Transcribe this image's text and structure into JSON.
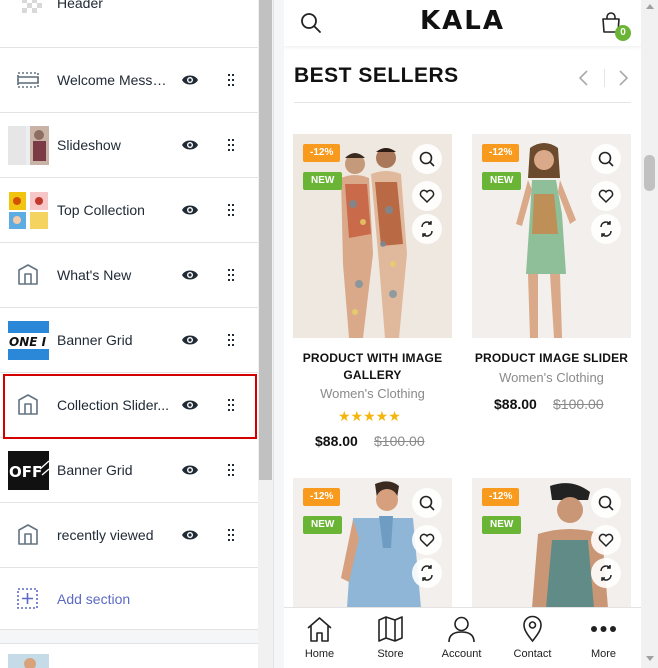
{
  "sidebar": {
    "sections": [
      {
        "label": "Header",
        "icon": "header-thumbnail"
      },
      {
        "label": "Welcome Messa...",
        "icon": "welcome-message-icon"
      },
      {
        "label": "Slideshow",
        "icon": "slideshow-thumbnail"
      },
      {
        "label": "Top Collection",
        "icon": "top-collection-thumbnail"
      },
      {
        "label": "What's New",
        "icon": "section-template-icon"
      },
      {
        "label": "Banner Grid",
        "icon": "banner-grid-thumbnail"
      },
      {
        "label": "Collection Slider...",
        "icon": "section-template-icon",
        "selected": true
      },
      {
        "label": "Banner Grid",
        "icon": "banner-grid-off-thumbnail"
      },
      {
        "label": "recently viewed",
        "icon": "section-template-icon"
      }
    ],
    "add_section_label": "Add section",
    "selected_outline_color": "#d40000"
  },
  "store": {
    "logo": "KALA",
    "cart_count": "0",
    "section_title": "BEST SELLERS",
    "products": [
      {
        "title": "PRODUCT WITH IMAGE GALLERY",
        "vendor": "Women's Clothing",
        "price": "$88.00",
        "compare_price": "$100.00",
        "sale_badge": "-12%",
        "new_badge": "NEW",
        "rating": 5,
        "stars": "★★★★★"
      },
      {
        "title": "PRODUCT IMAGE SLIDER",
        "vendor": "Women's Clothing",
        "price": "$88.00",
        "compare_price": "$100.00",
        "sale_badge": "-12%",
        "new_badge": "NEW"
      },
      {
        "sale_badge": "-12%",
        "new_badge": "NEW"
      },
      {
        "sale_badge": "-12%",
        "new_badge": "NEW"
      }
    ],
    "bottom_nav": [
      {
        "label": "Home",
        "icon": "home-icon"
      },
      {
        "label": "Store",
        "icon": "map-book-icon"
      },
      {
        "label": "Account",
        "icon": "account-icon"
      },
      {
        "label": "Contact",
        "icon": "location-pin-icon"
      },
      {
        "label": "More",
        "icon": "more-dots-icon"
      }
    ],
    "colors": {
      "sale": "#f79a1e",
      "new": "#6bb536",
      "stars": "#f5b50a"
    }
  }
}
